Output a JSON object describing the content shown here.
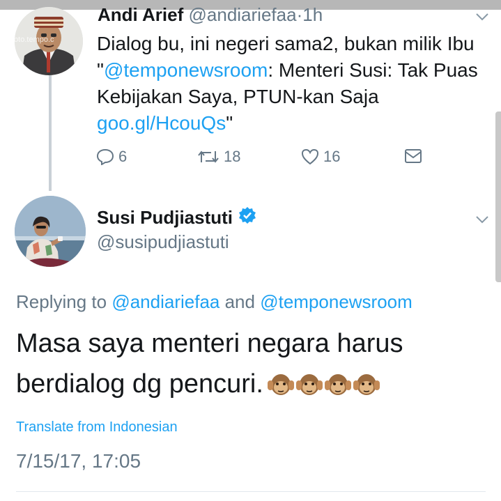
{
  "tweet1": {
    "author_name": "Andi Arief",
    "author_handle": "@andiariefaa",
    "time_sep": "·",
    "time": "1h",
    "avatar_watermark": "foto.tempo.c",
    "text_1": "Dialog bu, ini negeri sama2, bukan milik Ibu \"",
    "mention": "@temponewsroom",
    "text_2": ": Menteri Susi: Tak Puas Kebijakan Saya, PTUN-kan Saja ",
    "link": "goo.gl/HcouQs",
    "text_3": "\"",
    "replies": "6",
    "retweets": "18",
    "likes": "16"
  },
  "tweet2": {
    "author_name": "Susi Pudjiastuti",
    "author_handle": "@susipudjiastuti",
    "replying_prefix": "Replying to ",
    "reply_to_1": "@andiariefaa",
    "reply_and": " and ",
    "reply_to_2": "@temponewsroom",
    "text": "Masa saya menteri negara harus berdialog dg pencuri.",
    "emoji": "🙉",
    "translate_label": "Translate from Indonesian",
    "timestamp": "7/15/17, 17:05"
  },
  "colors": {
    "text": "#14171a",
    "secondary": "#657786",
    "link": "#1da1f2",
    "verified": "#1da1f2"
  },
  "icons": [
    "reply-icon",
    "retweet-icon",
    "like-icon",
    "direct-message-icon",
    "chevron-down-icon",
    "verified-badge-icon",
    "see-no-evil-monkey-emoji"
  ]
}
